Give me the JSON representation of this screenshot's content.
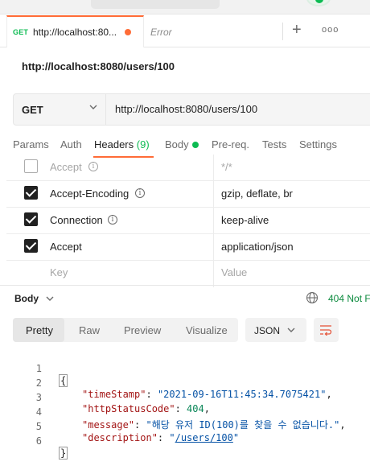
{
  "tab": {
    "method": "GET",
    "title": "http://localhost:80...",
    "error_tab_label": "Error",
    "new_tab": "+",
    "more": "ooo"
  },
  "request": {
    "name": "http://localhost:8080/users/100",
    "method": "GET",
    "url": "http://localhost:8080/users/100"
  },
  "request_tabs": {
    "params": "Params",
    "auth": "Auth",
    "headers": "Headers",
    "headers_count": "(9)",
    "body": "Body",
    "prereq": "Pre-req.",
    "tests": "Tests",
    "settings": "Settings"
  },
  "headers": [
    {
      "key": "Accept",
      "value": "*/*",
      "checked": false,
      "info": true,
      "muted": true
    },
    {
      "key": "Accept-Encoding",
      "value": "gzip, deflate, br",
      "checked": true,
      "info": true,
      "muted": false
    },
    {
      "key": "Connection",
      "value": "keep-alive",
      "checked": true,
      "info": true,
      "muted": false
    },
    {
      "key": "Accept",
      "value": "application/json",
      "checked": true,
      "info": false,
      "muted": false
    },
    {
      "key": "Key",
      "value": "Value",
      "checked": false,
      "info": false,
      "muted": true,
      "placeholder": true
    }
  ],
  "response": {
    "body_label": "Body",
    "status": "404 Not F",
    "formats": {
      "pretty": "Pretty",
      "raw": "Raw",
      "preview": "Preview",
      "visualize": "Visualize"
    },
    "language": "JSON",
    "lines": {
      "l1": "1",
      "l2": "2",
      "l3": "3",
      "l4": "4",
      "l5": "5",
      "l6": "6",
      "open_brace": "{",
      "close_brace": "}",
      "k1": "\"timeStamp\"",
      "v1": "\"2021-09-16T11:45:34.7075421\"",
      "k2": "\"httpStatusCode\"",
      "v2": "404",
      "k3": "\"message\"",
      "v3": "\"해당 유저 ID(100)를 찾을 수 없습니다.\"",
      "k4": "\"description\"",
      "v4_q1": "\"",
      "v4": "/users/100",
      "v4_q2": "\""
    }
  },
  "icon_names": [
    "info-icon",
    "globe-icon",
    "chevron-down-icon",
    "wrap-lines-icon",
    "check-icon"
  ],
  "colors": {
    "accent": "#ff6c37",
    "success": "#0cbb52"
  }
}
